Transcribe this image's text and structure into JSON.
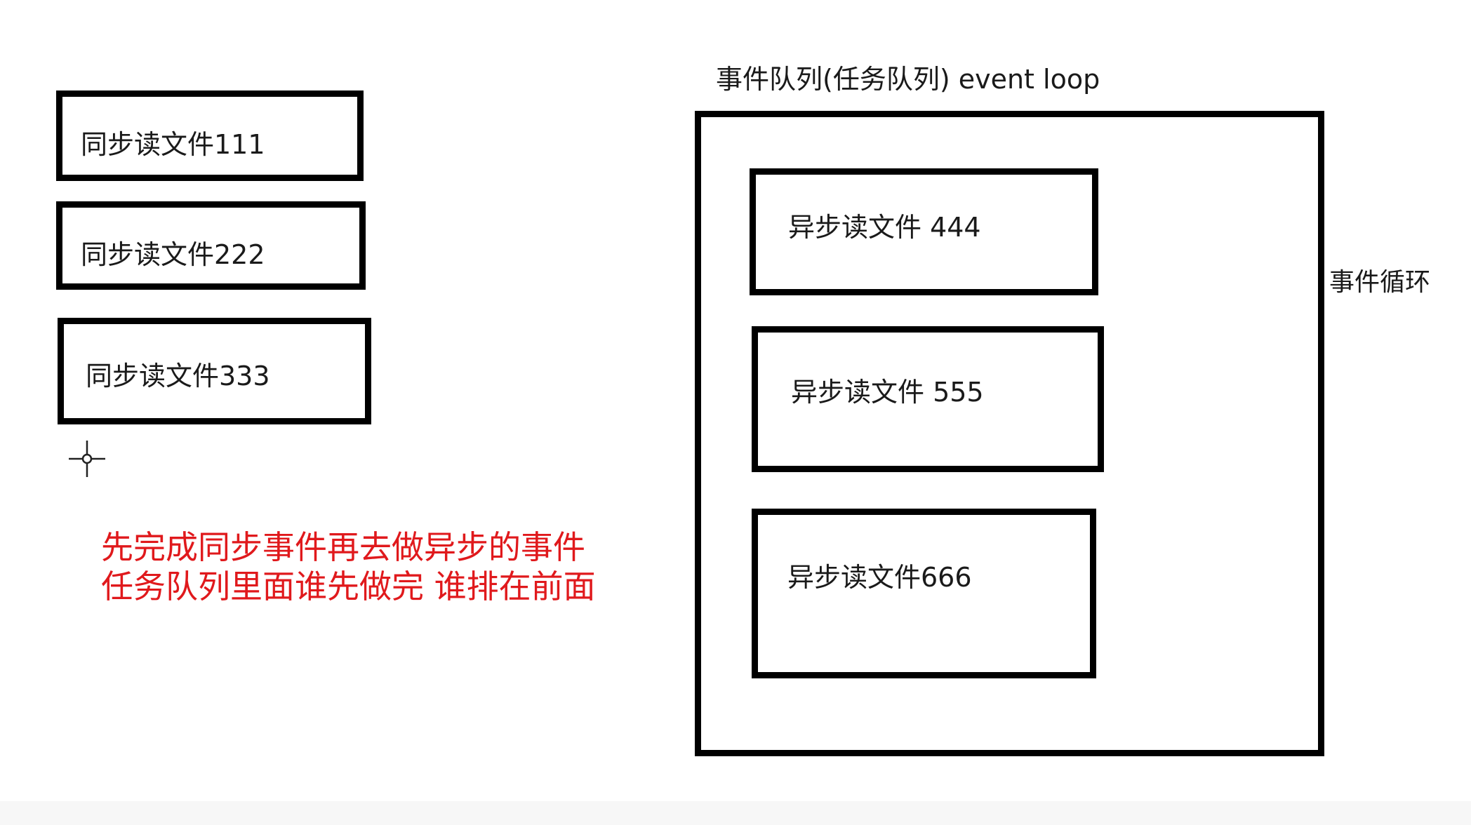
{
  "sync_tasks": [
    {
      "label": "同步读文件111"
    },
    {
      "label": "同步读文件222"
    },
    {
      "label": "同步读文件333"
    }
  ],
  "queue": {
    "title": "事件队列(任务队列)  event loop",
    "async_tasks": [
      {
        "label": "异步读文件 444"
      },
      {
        "label": "异步读文件 555"
      },
      {
        "label": "异步读文件666"
      }
    ]
  },
  "event_loop_label": "事件循环",
  "note": {
    "line1": "先完成同步事件再去做异步的事件",
    "line2": "任务队列里面谁先做完 谁排在前面",
    "color": "#e0191c"
  },
  "icons": {
    "cursor": "crosshair-cursor-icon"
  }
}
